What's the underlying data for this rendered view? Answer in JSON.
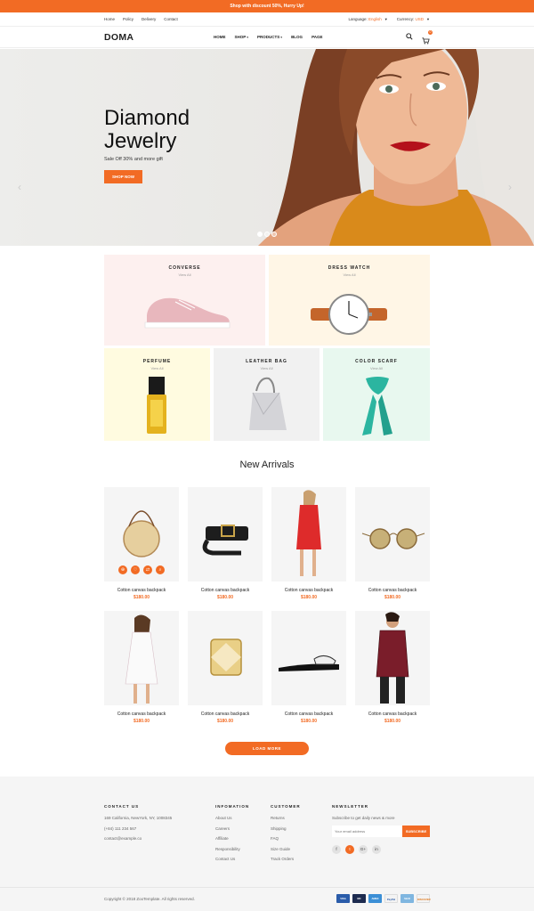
{
  "announcement": "Shop with discount 50%, Hurry Up!",
  "topbar": {
    "links": [
      "Home",
      "Policy",
      "Delivery",
      "Contact"
    ],
    "language_label": "Language:",
    "language_value": "English",
    "currency_label": "Currency:",
    "currency_value": "USD"
  },
  "header": {
    "logo": "DOMA",
    "nav": [
      "HOME",
      "SHOP",
      "PRODUCTS",
      "BLOG",
      "PAGE"
    ],
    "cart_count": "0"
  },
  "hero": {
    "title_line1": "Diamond",
    "title_line2": "Jewelry",
    "subtitle": "Sale Off 30% and more gift",
    "button": "SHOP NOW"
  },
  "categories": [
    {
      "title": "CONVERSE",
      "link": "View All"
    },
    {
      "title": "DRESS WATCH",
      "link": "View All"
    },
    {
      "title": "PERFUME",
      "link": "View All"
    },
    {
      "title": "LEATHER BAG",
      "link": "View All"
    },
    {
      "title": "COLOR SCARF",
      "link": "View All"
    }
  ],
  "new_arrivals": {
    "title": "New Arrivals",
    "products": [
      {
        "name": "Cotton canvas backpack",
        "price": "$180.00"
      },
      {
        "name": "Cotton canvas backpack",
        "price": "$180.00"
      },
      {
        "name": "Cotton canvas backpack",
        "price": "$180.00"
      },
      {
        "name": "Cotton canvas backpack",
        "price": "$180.00"
      },
      {
        "name": "Cotton canvas backpack",
        "price": "$180.00"
      },
      {
        "name": "Cotton canvas backpack",
        "price": "$180.00"
      },
      {
        "name": "Cotton canvas backpack",
        "price": "$180.00"
      },
      {
        "name": "Cotton canvas backpack",
        "price": "$180.00"
      }
    ],
    "load_more": "LOAD MORE"
  },
  "footer": {
    "contact": {
      "title": "CONTACT US",
      "lines": [
        "169 California, NewYork, NY, 1008345",
        "(+84) 111 234 567",
        "contact@example.co"
      ]
    },
    "information": {
      "title": "INFOMATION",
      "links": [
        "About Us",
        "Careers",
        "Affiliate",
        "Responsibility",
        "Contact Us"
      ]
    },
    "customer": {
      "title": "CUSTOMER",
      "links": [
        "Returns",
        "Shipping",
        "FAQ",
        "Size Guide",
        "Track Orders"
      ]
    },
    "newsletter": {
      "title": "NEWSLETTER",
      "description": "Subscribe to get daily news & more",
      "placeholder": "Your email address",
      "button": "SUBSCRIBE",
      "socials": [
        "f",
        "t",
        "G+",
        "in"
      ]
    },
    "copyright": "Copyright © 2018 ZooTemplate. All rights reserved.",
    "payments": [
      "VISA",
      "MC",
      "AMEX",
      "PayPal",
      "Skrill",
      "DISCOVER"
    ]
  },
  "colors": {
    "accent": "#f26b24",
    "footer_bg": "#f5f5f5"
  }
}
